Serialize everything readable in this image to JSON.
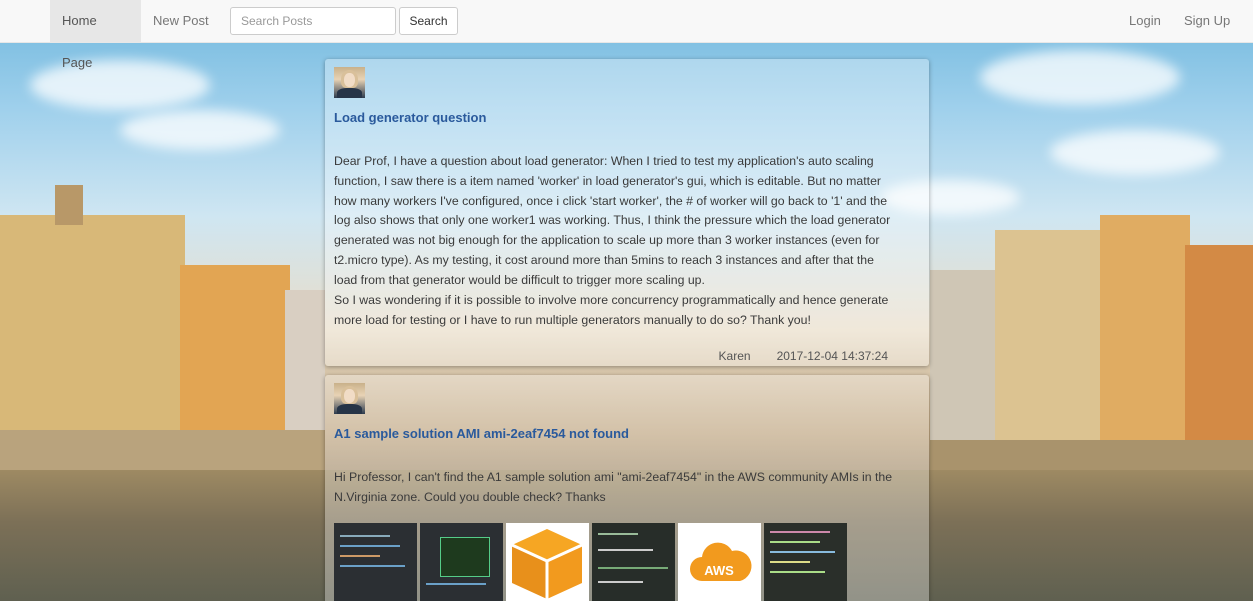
{
  "nav": {
    "home_label": "Home Page",
    "new_post_label": "New Post",
    "search_placeholder": "Search Posts",
    "search_button_label": "Search",
    "login_label": "Login",
    "signup_label": "Sign Up"
  },
  "posts": [
    {
      "title": "Load generator question",
      "body": "Dear Prof, I have a question about load generator: When I tried to test my application's auto scaling function, I saw there is a item named 'worker' in load generator's gui, which is editable. But no matter how many workers I've configured, once i click 'start worker', the # of worker will go back to '1' and the log also shows that only one worker1 was working. Thus, I think the pressure which the load generator generated was not big enough for the application to scale up more than 3 worker instances (even for t2.micro type). As my testing, it cost around more than 5mins to reach 3 instances and after that the load from that generator would be difficult to trigger more scaling up.",
      "body2": "So I was wondering if it is possible to involve more concurrency programmatically and hence generate more load for testing or I have to run multiple generators manually to do so? Thank you!",
      "author": "Karen",
      "timestamp": "2017-12-04 14:37:24"
    },
    {
      "title": "A1 sample solution AMI ami-2eaf7454 not found",
      "body": "Hi Professor, I can't find the A1 sample solution ami \"ami-2eaf7454\" in the AWS community AMIs in the N.Virginia zone. Could you double check? Thanks",
      "aws_label": "AWS"
    }
  ]
}
